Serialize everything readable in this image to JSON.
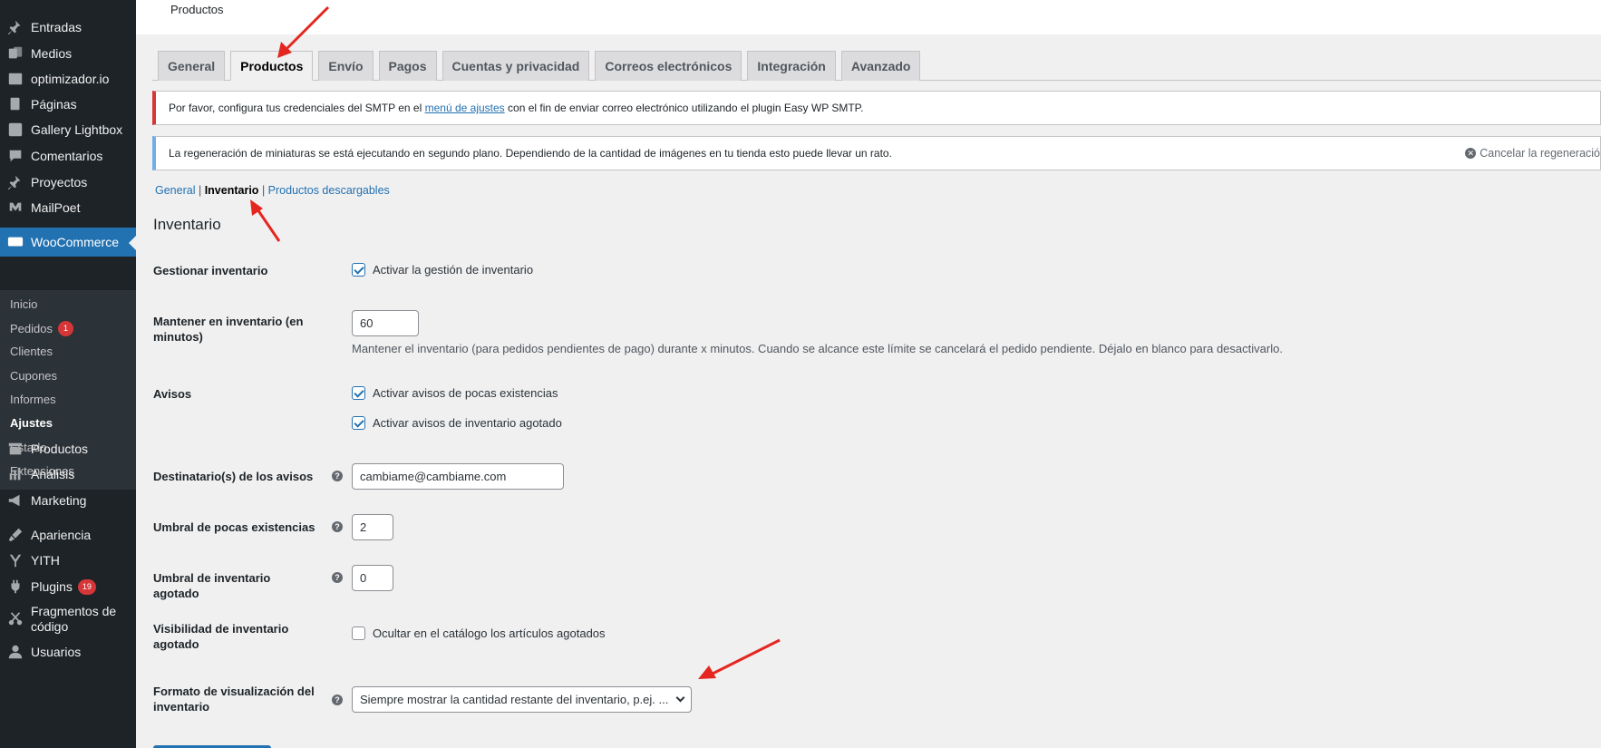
{
  "sidebar": {
    "items": [
      {
        "label": "Entradas",
        "icon": "pin-icon"
      },
      {
        "label": "Medios",
        "icon": "media-icon"
      },
      {
        "label": "optimizador.io",
        "icon": "image-icon"
      },
      {
        "label": "Páginas",
        "icon": "pages-icon"
      },
      {
        "label": "Gallery Lightbox",
        "icon": "gallery-icon"
      },
      {
        "label": "Comentarios",
        "icon": "comment-icon"
      },
      {
        "label": "Proyectos",
        "icon": "pin-icon"
      },
      {
        "label": "MailPoet",
        "icon": "mailpoet-icon"
      },
      {
        "label": "WooCommerce",
        "icon": "woocommerce-icon"
      },
      {
        "label": "Productos",
        "icon": "archive-icon"
      },
      {
        "label": "Análisis",
        "icon": "chart-bar-icon"
      },
      {
        "label": "Marketing",
        "icon": "megaphone-icon"
      },
      {
        "label": "Apariencia",
        "icon": "brush-icon"
      },
      {
        "label": "YITH",
        "icon": "yith-icon"
      },
      {
        "label": "Plugins",
        "icon": "plugin-icon",
        "badge": "19"
      },
      {
        "label": "Fragmentos de código",
        "icon": "scissors-icon"
      },
      {
        "label": "Usuarios",
        "icon": "user-icon"
      }
    ],
    "submenu": [
      {
        "label": "Inicio"
      },
      {
        "label": "Pedidos",
        "badge": "1"
      },
      {
        "label": "Clientes"
      },
      {
        "label": "Cupones"
      },
      {
        "label": "Informes"
      },
      {
        "label": "Ajustes"
      },
      {
        "label": "Estado"
      },
      {
        "label": "Extensiones"
      }
    ]
  },
  "header": {
    "title": "Productos"
  },
  "tabs": [
    "General",
    "Productos",
    "Envío",
    "Pagos",
    "Cuentas y privacidad",
    "Correos electrónicos",
    "Integración",
    "Avanzado"
  ],
  "notices": {
    "smtp_before": "Por favor, configura tus credenciales del SMTP en el ",
    "smtp_link": "menú de ajustes",
    "smtp_after": " con el fin de enviar correo electrónico utilizando el plugin Easy WP SMTP.",
    "regen": "La regeneración de miniaturas se está ejecutando en segundo plano. Dependiendo de la cantidad de imágenes en tu tienda esto puede llevar un rato.",
    "regen_cancel": "Cancelar la regeneració"
  },
  "subnav": {
    "general": "General",
    "inventario": "Inventario",
    "descargables": "Productos descargables",
    "sep": "|"
  },
  "section": {
    "title": "Inventario"
  },
  "form": {
    "manage_label": "Gestionar inventario",
    "manage_checkbox": "Activar la gestión de inventario",
    "hold_label": "Mantener en inventario (en minutos)",
    "hold_value": "60",
    "hold_desc": "Mantener el inventario (para pedidos pendientes de pago) durante x minutos. Cuando se alcance este límite se cancelará el pedido pendiente. Déjalo en blanco para desactivarlo.",
    "notices_label": "Avisos",
    "notice_low": "Activar avisos de pocas existencias",
    "notice_out": "Activar avisos de inventario agotado",
    "recipient_label": "Destinatario(s) de los avisos",
    "recipient_value": "cambiame@cambiame.com",
    "low_label": "Umbral de pocas existencias",
    "low_value": "2",
    "out_label": "Umbral de inventario agotado",
    "out_value": "0",
    "visibility_label": "Visibilidad de inventario agotado",
    "visibility_checkbox": "Ocultar en el catálogo los artículos agotados",
    "format_label": "Formato de visualización del inventario",
    "format_value": "Siempre mostrar la cantidad restante del inventario, p.ej. ..."
  },
  "colors": {
    "sidebar_bg": "#1d2327",
    "accent": "#2271b1",
    "badge": "#d63638",
    "arrow": "#e5261f"
  }
}
